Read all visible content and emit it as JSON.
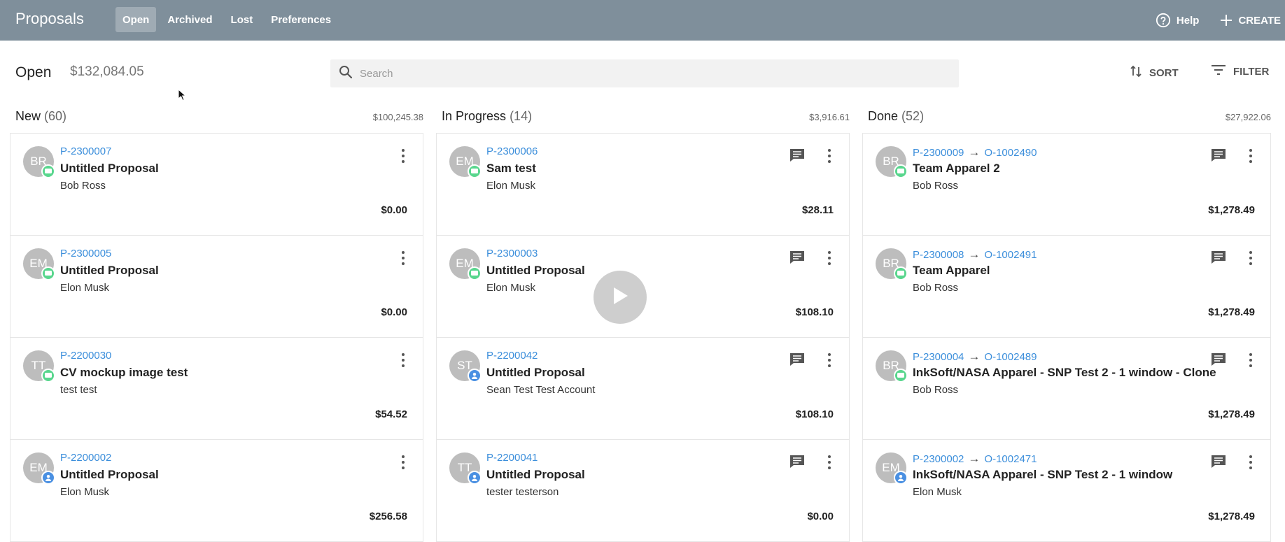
{
  "app": {
    "title": "Proposals"
  },
  "nav": {
    "tabs": [
      "Open",
      "Archived",
      "Lost",
      "Preferences"
    ],
    "active": "Open"
  },
  "top_actions": {
    "help": "Help",
    "create": "CREATE"
  },
  "subbar": {
    "title": "Open",
    "total": "$132,084.05",
    "search_placeholder": "Search",
    "sort": "SORT",
    "filter": "FILTER"
  },
  "columns": [
    {
      "name": "New",
      "count": "(60)",
      "total": "$100,245.38",
      "cards": [
        {
          "initials": "BR",
          "status": "green",
          "proposal_id": "P-2300007",
          "order_id": "",
          "title": "Untitled Proposal",
          "client": "Bob Ross",
          "amount": "$0.00",
          "comments": false
        },
        {
          "initials": "EM",
          "status": "green",
          "proposal_id": "P-2300005",
          "order_id": "",
          "title": "Untitled Proposal",
          "client": "Elon Musk",
          "amount": "$0.00",
          "comments": false
        },
        {
          "initials": "TT",
          "status": "green",
          "proposal_id": "P-2200030",
          "order_id": "",
          "title": "CV mockup image test",
          "client": "test test",
          "amount": "$54.52",
          "comments": false
        },
        {
          "initials": "EM",
          "status": "blue",
          "proposal_id": "P-2200002",
          "order_id": "",
          "title": "Untitled Proposal",
          "client": "Elon Musk",
          "amount": "$256.58",
          "comments": false
        }
      ]
    },
    {
      "name": "In Progress",
      "count": "(14)",
      "total": "$3,916.61",
      "cards": [
        {
          "initials": "EM",
          "status": "green",
          "proposal_id": "P-2300006",
          "order_id": "",
          "title": "Sam test",
          "client": "Elon Musk",
          "amount": "$28.11",
          "comments": true
        },
        {
          "initials": "EM",
          "status": "green",
          "proposal_id": "P-2300003",
          "order_id": "",
          "title": "Untitled Proposal",
          "client": "Elon Musk",
          "amount": "$108.10",
          "comments": true
        },
        {
          "initials": "ST",
          "status": "blue",
          "proposal_id": "P-2200042",
          "order_id": "",
          "title": "Untitled Proposal",
          "client": "Sean Test Test Account",
          "amount": "$108.10",
          "comments": true
        },
        {
          "initials": "TT",
          "status": "blue",
          "proposal_id": "P-2200041",
          "order_id": "",
          "title": "Untitled Proposal",
          "client": "tester testerson",
          "amount": "$0.00",
          "comments": true
        }
      ]
    },
    {
      "name": "Done",
      "count": "(52)",
      "total": "$27,922.06",
      "cards": [
        {
          "initials": "BR",
          "status": "green",
          "proposal_id": "P-2300009",
          "order_id": "O-1002490",
          "title": "Team Apparel 2",
          "client": "Bob Ross",
          "amount": "$1,278.49",
          "comments": true
        },
        {
          "initials": "BR",
          "status": "green",
          "proposal_id": "P-2300008",
          "order_id": "O-1002491",
          "title": "Team Apparel",
          "client": "Bob Ross",
          "amount": "$1,278.49",
          "comments": true
        },
        {
          "initials": "BR",
          "status": "green",
          "proposal_id": "P-2300004",
          "order_id": "O-1002489",
          "title": "InkSoft/NASA Apparel - SNP Test 2 - 1 window - Clone",
          "client": "Bob Ross",
          "amount": "$1,278.49",
          "comments": true
        },
        {
          "initials": "EM",
          "status": "blue",
          "proposal_id": "P-2300002",
          "order_id": "O-1002471",
          "title": "InkSoft/NASA Apparel - SNP Test 2 - 1 window",
          "client": "Elon Musk",
          "amount": "$1,278.49",
          "comments": true
        }
      ]
    }
  ],
  "colors": {
    "topbar": "#7f8f9b",
    "link": "#3b8edb",
    "status_green": "#58d68d",
    "status_blue": "#4a90e2"
  },
  "icons": [
    "help-circle-icon",
    "plus-icon",
    "search-icon",
    "sort-icon",
    "filter-icon",
    "comment-icon",
    "more-vert-icon",
    "play-icon"
  ]
}
